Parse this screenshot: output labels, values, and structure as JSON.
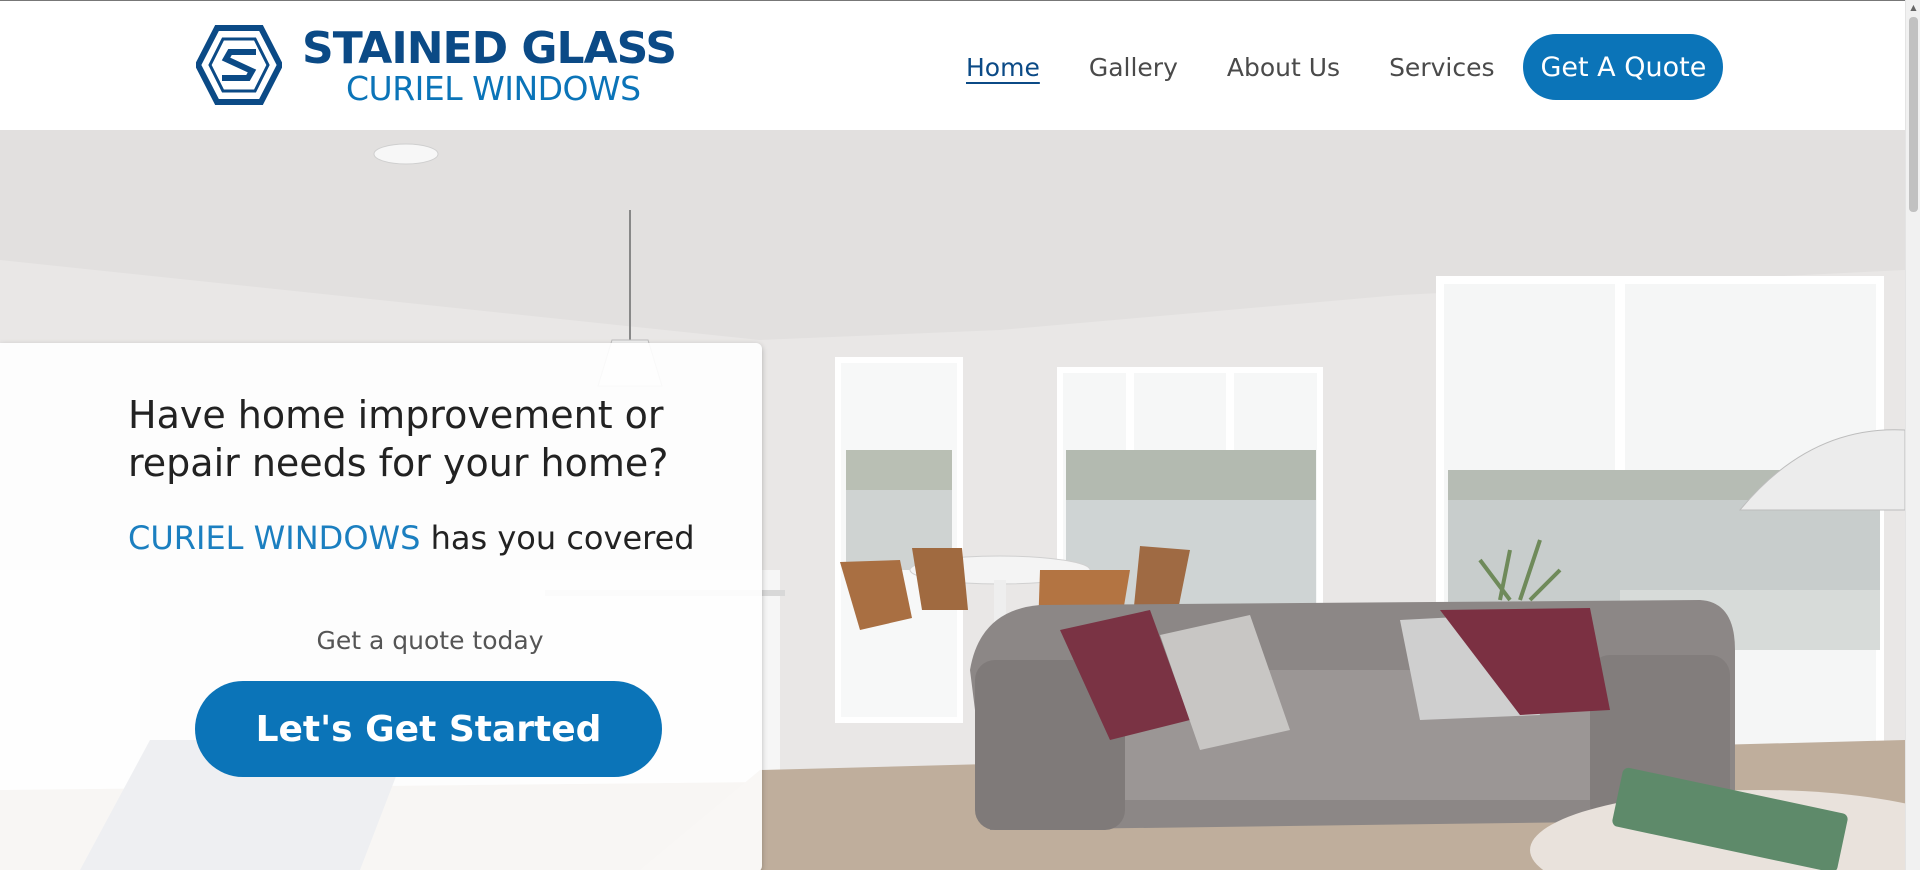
{
  "colors": {
    "brand_navy": "#0b4a86",
    "brand_blue": "#0b74b8",
    "accent_text_blue": "#1b7fc0"
  },
  "logo": {
    "line1": "STAINED GLASS",
    "line2": "CURIEL WINDOWS",
    "icon": "stained-glass-logo-mark"
  },
  "nav": {
    "items": [
      {
        "label": "Home",
        "active": true
      },
      {
        "label": "Gallery",
        "active": false
      },
      {
        "label": "About Us",
        "active": false
      },
      {
        "label": "Services",
        "active": false
      }
    ],
    "quote_button": "Get A Quote"
  },
  "hero": {
    "headline": "Have home improvement or repair needs for your home?",
    "sub_brand": "CURIEL WINDOWS",
    "sub_rest": " has you covered",
    "cta_label": "Get a quote today",
    "cta_button": "Let's Get Started"
  }
}
